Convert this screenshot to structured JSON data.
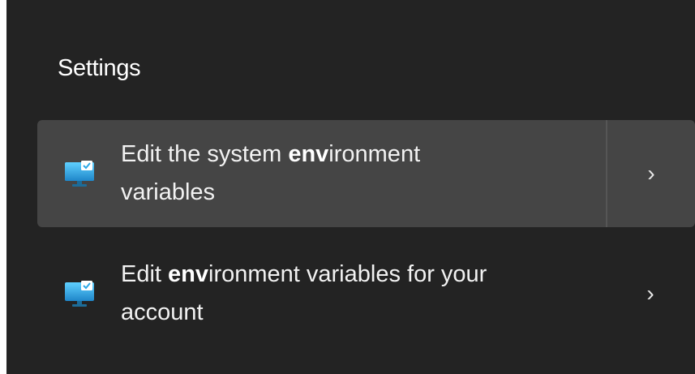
{
  "section": {
    "title": "Settings"
  },
  "results": [
    {
      "text_before": "Edit the system ",
      "match": "env",
      "text_after_line1": "ironment",
      "text_line2": "variables",
      "icon": "computer-settings-icon",
      "arrow": "chevron-right-icon",
      "selected": true
    },
    {
      "text_before": "Edit ",
      "match": "env",
      "text_after_line1": "ironment variables for your",
      "text_line2": "account",
      "icon": "computer-settings-icon",
      "arrow": "chevron-right-icon",
      "selected": false
    }
  ],
  "colors": {
    "background": "#232323",
    "selected_row": "#454545",
    "icon_screen": "#2aa7e6",
    "icon_badge": "#ffffff"
  }
}
